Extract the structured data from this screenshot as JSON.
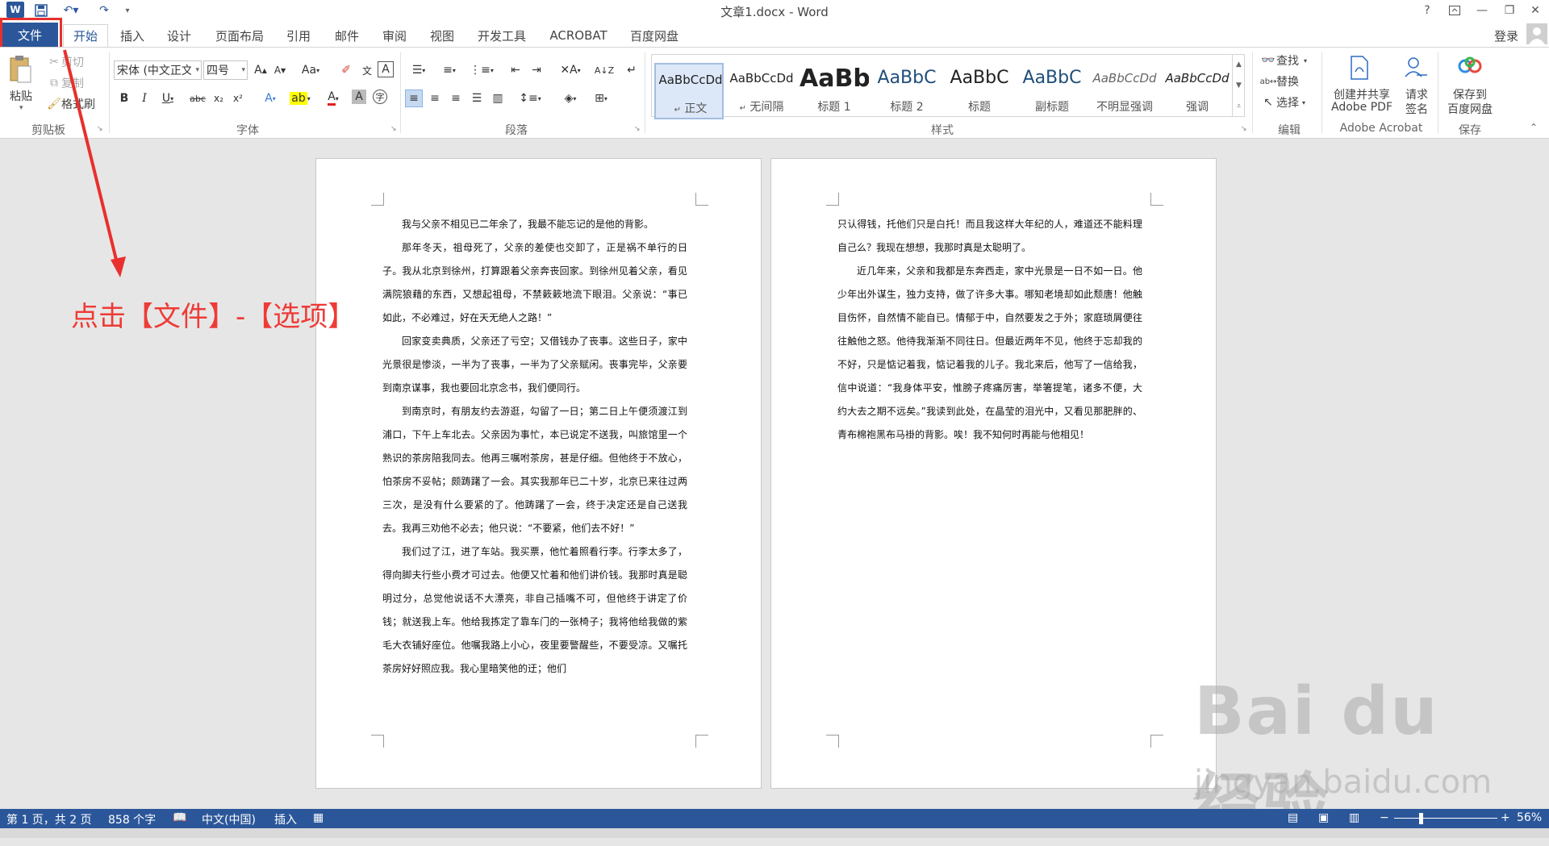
{
  "window": {
    "title": "文章1.docx - Word",
    "help": "?",
    "signin": "登录",
    "qat_icons": [
      "word-logo",
      "save-icon",
      "undo-icon",
      "redo-icon",
      "customize-icon"
    ]
  },
  "tabs": [
    "文件",
    "开始",
    "插入",
    "设计",
    "页面布局",
    "引用",
    "邮件",
    "审阅",
    "视图",
    "开发工具",
    "ACROBAT",
    "百度网盘"
  ],
  "ribbon": {
    "clipboard": {
      "paste": "粘贴",
      "cut": "剪切",
      "copy": "复制",
      "format_painter": "格式刷",
      "label": "剪贴板"
    },
    "font": {
      "name": "宋体 (中文正文",
      "size": "四号",
      "label": "字体",
      "case": "Aa"
    },
    "paragraph": {
      "label": "段落"
    },
    "styles": {
      "label": "样式",
      "items": [
        {
          "sample": "AaBbCcDd",
          "name": "正文"
        },
        {
          "sample": "AaBbCcDd",
          "name": "无间隔"
        },
        {
          "sample": "AaBb",
          "name": "标题 1"
        },
        {
          "sample": "AaBbC",
          "name": "标题 2"
        },
        {
          "sample": "AaBbC",
          "name": "标题"
        },
        {
          "sample": "AaBbC",
          "name": "副标题"
        },
        {
          "sample": "AaBbCcDd",
          "name": "不明显强调"
        },
        {
          "sample": "AaBbCcDd",
          "name": "强调"
        }
      ]
    },
    "editing": {
      "find": "查找",
      "replace": "替换",
      "select": "选择",
      "label": "编辑"
    },
    "acrobat": {
      "create_share": "创建并共享",
      "create_share_2": "Adobe PDF",
      "request_sign": "请求",
      "request_sign_2": "签名",
      "label": "Adobe Acrobat"
    },
    "save": {
      "save_to": "保存到",
      "save_to_2": "百度网盘",
      "label": "保存"
    }
  },
  "annotation": "点击【文件】-【选项】",
  "document": {
    "page1": [
      "我与父亲不相见已二年余了，我最不能忘记的是他的背影。",
      "那年冬天，祖母死了，父亲的差使也交卸了，正是祸不单行的日子。我从北京到徐州，打算跟着父亲奔丧回家。到徐州见着父亲，看见满院狼藉的东西，又想起祖母，不禁簌簌地流下眼泪。父亲说：“事已如此，不必难过，好在天无绝人之路！”",
      "回家变卖典质，父亲还了亏空；又借钱办了丧事。这些日子，家中光景很是惨淡，一半为了丧事，一半为了父亲赋闲。丧事完毕，父亲要到南京谋事，我也要回北京念书，我们便同行。",
      "到南京时，有朋友约去游逛，勾留了一日；第二日上午便须渡江到浦口，下午上车北去。父亲因为事忙，本已说定不送我，叫旅馆里一个熟识的茶房陪我同去。他再三嘱咐茶房，甚是仔细。但他终于不放心，怕茶房不妥帖；颇踌躇了一会。其实我那年已二十岁，北京已来往过两三次，是没有什么要紧的了。他踌躇了一会，终于决定还是自己送我去。我再三劝他不必去；他只说：“不要紧，他们去不好！”",
      "我们过了江，进了车站。我买票，他忙着照看行李。行李太多了，得向脚夫行些小费才可过去。他便又忙着和他们讲价钱。我那时真是聪明过分，总觉他说话不大漂亮，非自己插嘴不可，但他终于讲定了价钱；就送我上车。他给我拣定了靠车门的一张椅子；我将他给我做的紫毛大衣铺好座位。他嘱我路上小心，夜里要警醒些，不要受凉。又嘱托茶房好好照应我。我心里暗笑他的迂；他们"
    ],
    "page2": [
      "只认得钱，托他们只是白托！而且我这样大年纪的人，难道还不能料理自己么？我现在想想，我那时真是太聪明了。",
      "近几年来，父亲和我都是东奔西走，家中光景是一日不如一日。他少年出外谋生，独力支持，做了许多大事。哪知老境却如此颓唐！他触目伤怀，自然情不能自已。情郁于中，自然要发之于外；家庭琐屑便往往触他之怒。他待我渐渐不同往日。但最近两年不见，他终于忘却我的不好，只是惦记着我，惦记着我的儿子。我北来后，他写了一信给我，信中说道：“我身体平安，惟膀子疼痛厉害，举箸提笔，诸多不便，大约大去之期不远矣。”我读到此处，在晶莹的泪光中，又看见那肥胖的、青布棉袍黑布马褂的背影。唉！我不知何时再能与他相见！"
    ]
  },
  "watermark": {
    "main": "Bai du 经验",
    "sub": "jingyan.baidu.com"
  },
  "statusbar": {
    "page": "第 1 页，共 2 页",
    "words": "858 个字",
    "language": "中文(中国)",
    "mode": "插入",
    "zoom": "56%",
    "zoom_level": 0.56
  },
  "colors": {
    "accent": "#2b579a",
    "annotation": "#e8302e"
  }
}
